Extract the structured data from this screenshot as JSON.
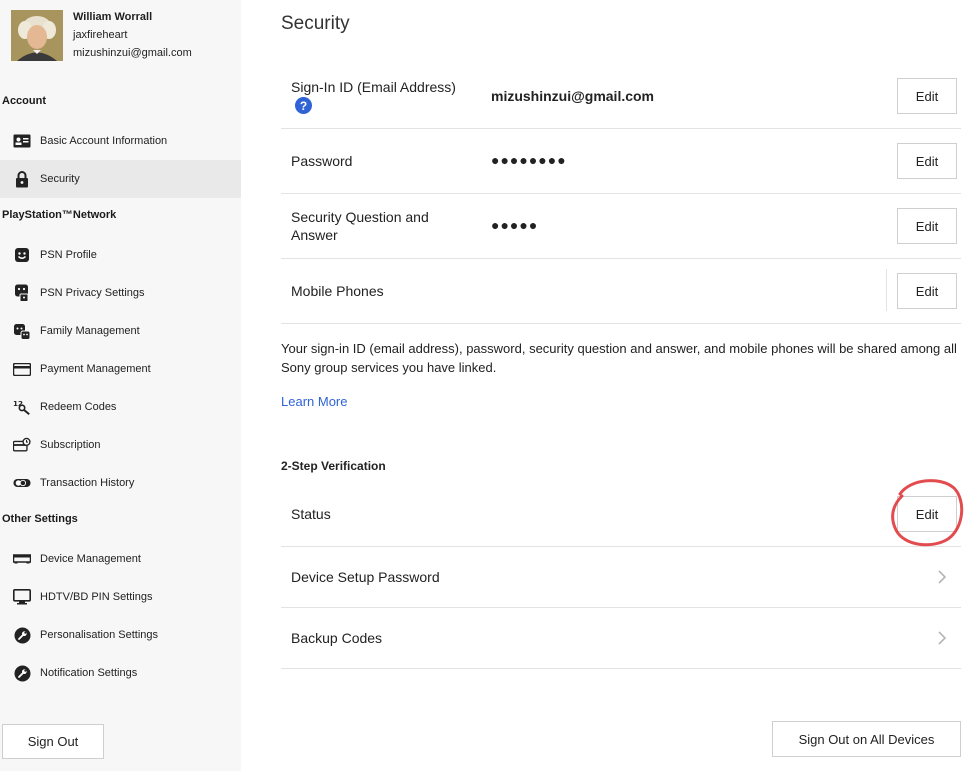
{
  "profile": {
    "name": "William Worrall",
    "username": "jaxfireheart",
    "email": "mizushinzui@gmail.com"
  },
  "sidebar": {
    "sections": [
      {
        "title": "Account",
        "items": [
          {
            "label": "Basic Account Information",
            "icon": "id-card-icon"
          },
          {
            "label": "Security",
            "icon": "lock-icon",
            "active": true
          }
        ]
      },
      {
        "title": "PlayStation™Network",
        "items": [
          {
            "label": "PSN Profile",
            "icon": "smiley-face-icon"
          },
          {
            "label": "PSN Privacy Settings",
            "icon": "privacy-icon"
          },
          {
            "label": "Family Management",
            "icon": "family-icon"
          },
          {
            "label": "Payment Management",
            "icon": "credit-card-icon"
          },
          {
            "label": "Redeem Codes",
            "icon": "redeem-code-icon"
          },
          {
            "label": "Subscription",
            "icon": "subscription-icon"
          },
          {
            "label": "Transaction History",
            "icon": "transaction-icon"
          }
        ]
      },
      {
        "title": "Other Settings",
        "items": [
          {
            "label": "Device Management",
            "icon": "device-icon"
          },
          {
            "label": "HDTV/BD PIN Settings",
            "icon": "monitor-icon"
          },
          {
            "label": "Personalisation Settings",
            "icon": "wrench-icon"
          },
          {
            "label": "Notification Settings",
            "icon": "wrench-icon"
          }
        ]
      }
    ],
    "sign_out": "Sign Out"
  },
  "main": {
    "title": "Security",
    "rows": [
      {
        "label": "Sign-In ID (Email Address)",
        "value": "mizushinzui@gmail.com",
        "button": "Edit"
      },
      {
        "label": "Password",
        "value": "●●●●●●●●",
        "button": "Edit"
      },
      {
        "label": "Security Question and Answer",
        "value": "●●●●●",
        "button": "Edit"
      },
      {
        "label": "Mobile Phones",
        "value": "",
        "button": "Edit"
      }
    ],
    "help_glyph": "?",
    "info_text": "Your sign-in ID (email address), password, security question and answer, and mobile phones will be shared among all Sony group services you have linked.",
    "learn_more": "Learn More",
    "two_step": {
      "title": "2-Step Verification",
      "status_label": "Status",
      "status_button": "Edit",
      "device_setup_password": "Device Setup Password",
      "backup_codes": "Backup Codes"
    },
    "sign_out_all": "Sign Out on All Devices"
  },
  "colors": {
    "accent_blue": "#2f63d6",
    "highlight_red": "#e0393c",
    "sidebar_bg": "#f7f7f7",
    "active_item_bg": "#e9e9e9"
  }
}
